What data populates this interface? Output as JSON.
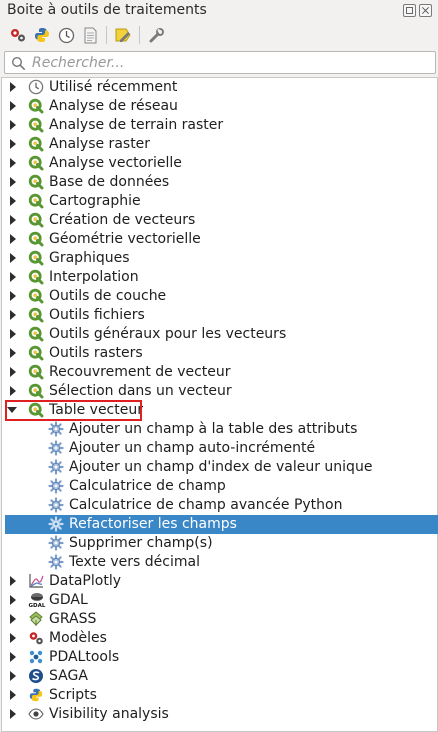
{
  "panel": {
    "title": "Boite à outils de traitements"
  },
  "search": {
    "placeholder": "Rechercher..."
  },
  "tree": {
    "groups": [
      {
        "label": "Utilisé récemment",
        "icon": "clock-icon"
      },
      {
        "label": "Analyse de réseau",
        "icon": "qgis-icon"
      },
      {
        "label": "Analyse de terrain raster",
        "icon": "qgis-icon"
      },
      {
        "label": "Analyse raster",
        "icon": "qgis-icon"
      },
      {
        "label": "Analyse vectorielle",
        "icon": "qgis-icon"
      },
      {
        "label": "Base de données",
        "icon": "qgis-icon"
      },
      {
        "label": "Cartographie",
        "icon": "qgis-icon"
      },
      {
        "label": "Création de vecteurs",
        "icon": "qgis-icon"
      },
      {
        "label": "Géométrie vectorielle",
        "icon": "qgis-icon"
      },
      {
        "label": "Graphiques",
        "icon": "qgis-icon"
      },
      {
        "label": "Interpolation",
        "icon": "qgis-icon"
      },
      {
        "label": "Outils de couche",
        "icon": "qgis-icon"
      },
      {
        "label": "Outils fichiers",
        "icon": "qgis-icon"
      },
      {
        "label": "Outils généraux pour les vecteurs",
        "icon": "qgis-icon"
      },
      {
        "label": "Outils rasters",
        "icon": "qgis-icon"
      },
      {
        "label": "Recouvrement de vecteur",
        "icon": "qgis-icon"
      },
      {
        "label": "Sélection dans un vecteur",
        "icon": "qgis-icon"
      }
    ],
    "expanded_group": {
      "label": "Table vecteur",
      "icon": "qgis-icon",
      "children": [
        "Ajouter un champ à la table des attributs",
        "Ajouter un champ auto-incrémenté",
        "Ajouter un champ d'index de valeur unique",
        "Calculatrice de champ",
        "Calculatrice de champ avancée Python",
        "Refactoriser les champs",
        "Supprimer champ(s)",
        "Texte vers décimal"
      ],
      "selected_child": "Refactoriser les champs"
    },
    "providers": [
      {
        "label": "DataPlotly",
        "icon": "dataplotly-icon"
      },
      {
        "label": "GDAL",
        "icon": "gdal-icon"
      },
      {
        "label": "GRASS",
        "icon": "grass-icon"
      },
      {
        "label": "Modèles",
        "icon": "models-icon"
      },
      {
        "label": "PDALtools",
        "icon": "pdal-icon"
      },
      {
        "label": "SAGA",
        "icon": "saga-icon"
      },
      {
        "label": "Scripts",
        "icon": "python-icon"
      },
      {
        "label": "Visibility analysis",
        "icon": "eye-icon"
      }
    ]
  },
  "colors": {
    "selection": "#3a87c8",
    "highlight_border": "#e02020",
    "qgis_green": "#589632"
  }
}
